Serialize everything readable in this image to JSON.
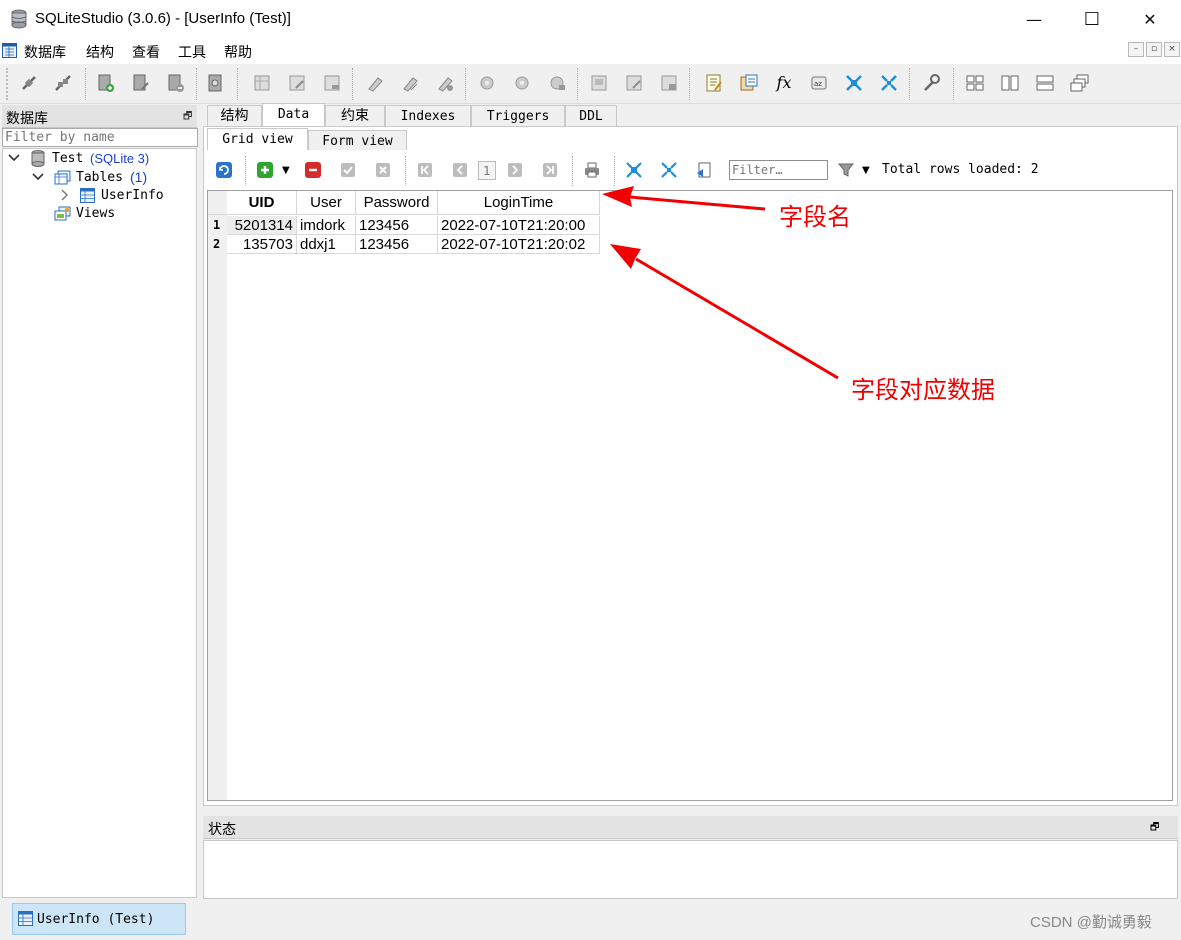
{
  "window": {
    "title": "SQLiteStudio (3.0.6) - [UserInfo (Test)]",
    "minimize": "—",
    "maximize": "☐",
    "close": "✕"
  },
  "menu": [
    "数据库",
    "结构",
    "查看",
    "工具",
    "帮助"
  ],
  "db_panel": {
    "title": "数据库",
    "filter_placeholder": "Filter by name",
    "tree": {
      "db_name": "Test",
      "db_type": "(SQLite 3)",
      "tables_label": "Tables",
      "tables_count": "(1)",
      "table_name": "UserInfo",
      "views_label": "Views"
    }
  },
  "tabs": [
    "结构",
    "Data",
    "约束",
    "Indexes",
    "Triggers",
    "DDL"
  ],
  "active_tab": "Data",
  "subtabs": [
    "Grid view",
    "Form view"
  ],
  "active_subtab": "Grid view",
  "grid_toolbar": {
    "page_number": "1",
    "filter_placeholder": "Filter…",
    "rows_loaded": "Total rows loaded: 2"
  },
  "grid": {
    "columns": [
      "UID",
      "User",
      "Password",
      "LoginTime"
    ],
    "rows": [
      {
        "num": "1",
        "UID": "5201314",
        "User": "imdork",
        "Password": "123456",
        "LoginTime": "2022-07-10T21:20:00"
      },
      {
        "num": "2",
        "UID": "135703",
        "User": "ddxj1",
        "Password": "123456",
        "LoginTime": "2022-07-10T21:20:02"
      }
    ]
  },
  "status_panel": {
    "title": "状态"
  },
  "taskbar": {
    "label": "UserInfo (Test)"
  },
  "annotations": {
    "field_names": "字段名",
    "field_data": "字段对应数据"
  },
  "watermark": "CSDN @勤诚勇毅",
  "colors": {
    "annotation_red": "#f20000",
    "selection_blue": "#cde6f7",
    "link_blue": "#1a3fd6"
  }
}
